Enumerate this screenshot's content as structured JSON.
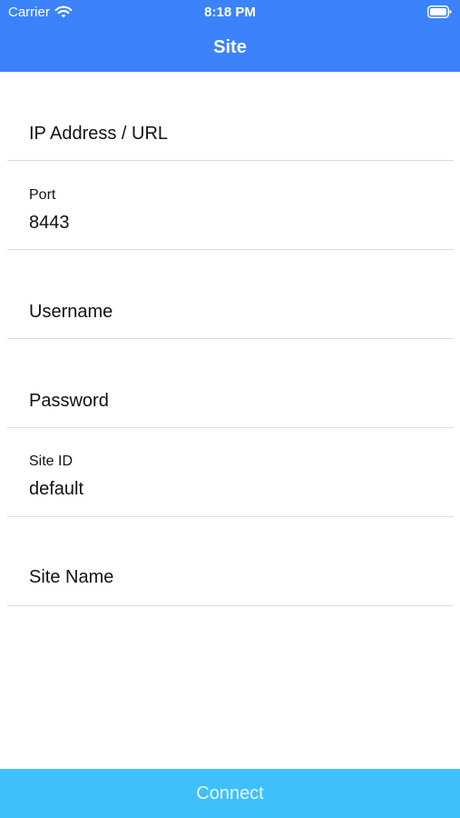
{
  "status_bar": {
    "carrier": "Carrier",
    "time": "8:18 PM",
    "wifi_icon": "wifi-icon",
    "battery_icon": "battery-icon"
  },
  "nav": {
    "title": "Site"
  },
  "form": {
    "ip_address": {
      "placeholder": "IP Address / URL"
    },
    "port": {
      "label": "Port",
      "value": "8443"
    },
    "username": {
      "placeholder": "Username"
    },
    "password": {
      "placeholder": "Password"
    },
    "site_id": {
      "label": "Site ID",
      "value": "default"
    },
    "site_name": {
      "placeholder": "Site Name"
    }
  },
  "actions": {
    "connect_label": "Connect"
  },
  "colors": {
    "header_blue": "#3b82fb",
    "button_blue": "#3ec1fb",
    "separator": "#dcdcdc"
  }
}
